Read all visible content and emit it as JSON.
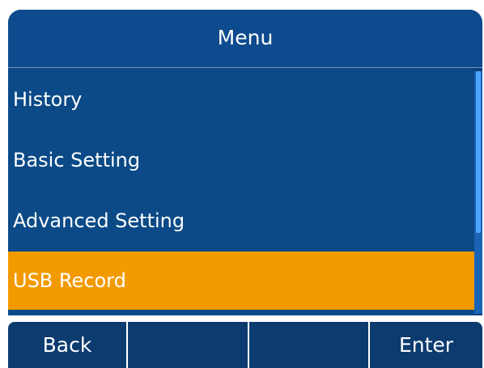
{
  "window": {
    "title": "Menu"
  },
  "menu": {
    "items": [
      {
        "label": "History"
      },
      {
        "label": "Basic Setting"
      },
      {
        "label": "Advanced Setting"
      },
      {
        "label": "USB Record"
      }
    ],
    "selected_index": 3
  },
  "softkeys": [
    {
      "label": "Back"
    },
    {
      "label": ""
    },
    {
      "label": ""
    },
    {
      "label": "Enter"
    }
  ],
  "colors": {
    "background": "#0b4a87",
    "title_bar": "#0d4a8e",
    "selection": "#f39a00",
    "softkey": "#0c3b6f",
    "text": "#ffffff"
  }
}
